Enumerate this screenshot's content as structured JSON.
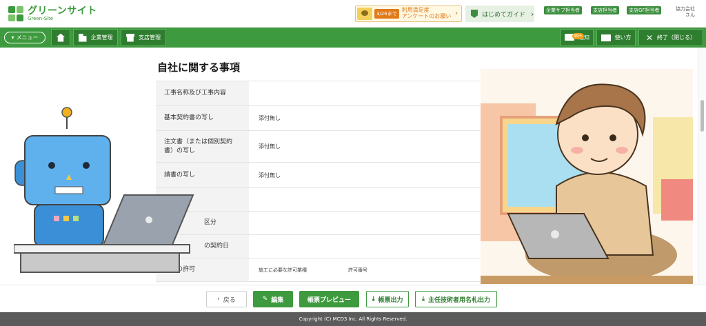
{
  "header": {
    "logo_title": "グリーンサイト",
    "logo_sub": "Green-Site",
    "survey_date": "3/26まで",
    "survey_line1": "利用満足度",
    "survey_line2": "アンケートのお願い",
    "guide_label": "はじめてガイド",
    "roles": [
      "企業サブ担当者",
      "支店担当者",
      "支店GF担当者"
    ],
    "company_line1": "協力会社",
    "company_line2": "さん"
  },
  "nav": {
    "menu_label": "メニュー",
    "corp_mgmt": "企業管理",
    "branch_mgmt": "支店管理",
    "notice_badge": "99+",
    "notice_label": "通知",
    "howto_label": "使い方",
    "exit_label": "終了（閉じる）"
  },
  "section": {
    "title": "自社に関する事項",
    "rows": [
      {
        "label": "工事名称及び工事内容",
        "value": ""
      },
      {
        "label": "基本契約書の写し",
        "value": "添付無し"
      },
      {
        "label": "注文書（または個別契約書）の写し",
        "value": "添付無し"
      },
      {
        "label": "請書の写し",
        "value": "添付無し"
      },
      {
        "label": "",
        "value": ""
      },
      {
        "label": "区分",
        "value": ""
      },
      {
        "label": "の契約日",
        "value": ""
      },
      {
        "label": "の許可",
        "value": "",
        "sub1": "施工に必要な許可業種",
        "sub2": "許可番号"
      }
    ]
  },
  "actions": {
    "back": "戻る",
    "edit": "編集",
    "preview": "帳票プレビュー",
    "output": "帳票出力",
    "nameplate": "主任技術者用名札出力"
  },
  "footer": {
    "copyright": "Copyright (C) MCD3 Inc. All Rights Reserved."
  },
  "colors": {
    "brand": "#3e9a3e",
    "brand_dark": "#2f7e30"
  }
}
